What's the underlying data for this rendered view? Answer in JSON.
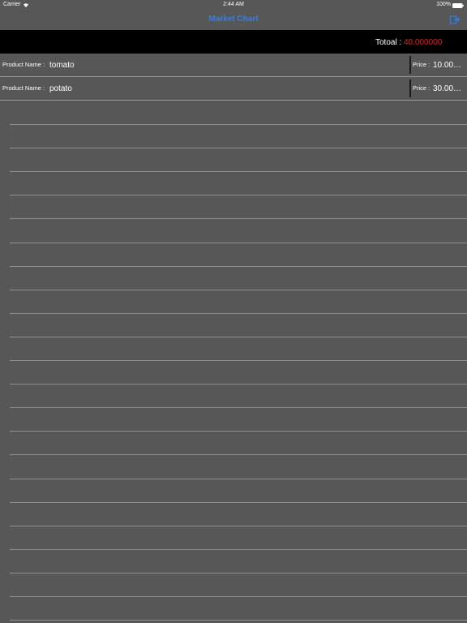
{
  "status_bar": {
    "carrier": "Carrier",
    "time": "2:44 AM",
    "battery": "100%"
  },
  "nav": {
    "title": "Market Chart",
    "title_color": "#2f7ff0",
    "action_icon": "export-icon"
  },
  "total": {
    "label": "Totoal :",
    "value": "40.000000",
    "value_color": "#e21b1b"
  },
  "products": [
    {
      "name_label": "Product Name :",
      "name": "tomato",
      "price_label": "Price :",
      "price": "10.000000"
    },
    {
      "name_label": "Product Name :",
      "name": "potato",
      "price_label": "Price :",
      "price": "30.000000"
    }
  ]
}
